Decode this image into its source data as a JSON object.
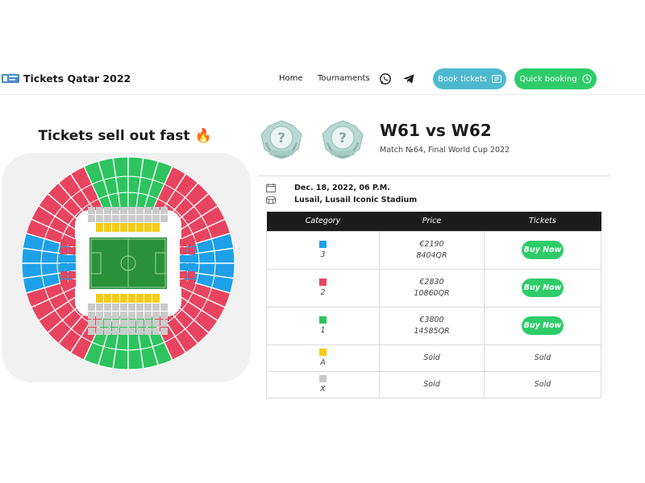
{
  "header": {
    "logo_text": "Tickets Qatar 2022",
    "nav": {
      "home": "Home",
      "tournaments": "Tournaments"
    },
    "book_tickets_label": "Book tickets",
    "quick_booking_label": "Quick booking",
    "colors": {
      "book": "#4db8cf",
      "quick": "#2dcc69"
    }
  },
  "stadium": {
    "title": "Tickets sell out fast 🔥",
    "colors": {
      "cat1": "#2dc45f",
      "cat2": "#e8445f",
      "cat3": "#1ea0e8",
      "catA": "#f7cc14",
      "catX": "#cbcbcb",
      "pitch": "#2a9138"
    }
  },
  "match": {
    "title": "W61 vs W62",
    "subtitle": "Match №64, Final World Cup 2022",
    "date": "Dec. 18, 2022, 06 P.M.",
    "venue": "Lusail, Lusail Iconic Stadium"
  },
  "table": {
    "headers": [
      "Category",
      "Price",
      "Tickets"
    ],
    "buy_label": "Buy Now",
    "rows": [
      {
        "category": "3",
        "color": "#1ea0e8",
        "price_eur": "€2190",
        "price_qr": "8404QR",
        "status": "buy"
      },
      {
        "category": "2",
        "color": "#e8445f",
        "price_eur": "€2830",
        "price_qr": "10860QR",
        "status": "buy"
      },
      {
        "category": "1",
        "color": "#2dc45f",
        "price_eur": "€3800",
        "price_qr": "14585QR",
        "status": "buy"
      },
      {
        "category": "A",
        "color": "#f7cc14",
        "price": "Sold",
        "tickets": "Sold",
        "status": "sold"
      },
      {
        "category": "X",
        "color": "#cbcbcb",
        "price": "Sold",
        "tickets": "Sold",
        "status": "sold"
      }
    ]
  }
}
